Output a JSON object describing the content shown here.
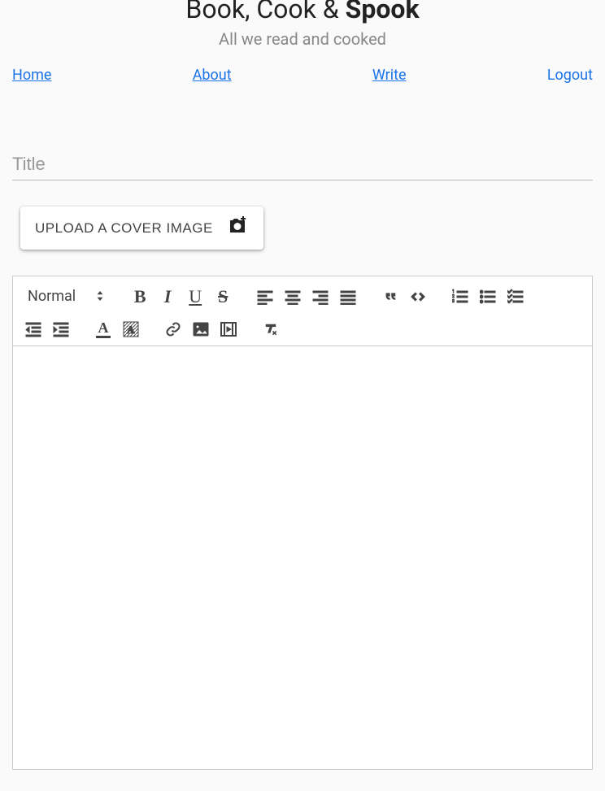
{
  "header": {
    "title_part1": "Book, Cook & ",
    "title_part2": "Spook",
    "subtitle": "All we read and cooked"
  },
  "nav": {
    "home": "Home",
    "about": "About",
    "write": "Write",
    "logout": "Logout"
  },
  "form": {
    "title_placeholder": "Title",
    "title_value": "",
    "upload_label": "Upload a cover image"
  },
  "toolbar": {
    "heading_picker": "Normal"
  }
}
